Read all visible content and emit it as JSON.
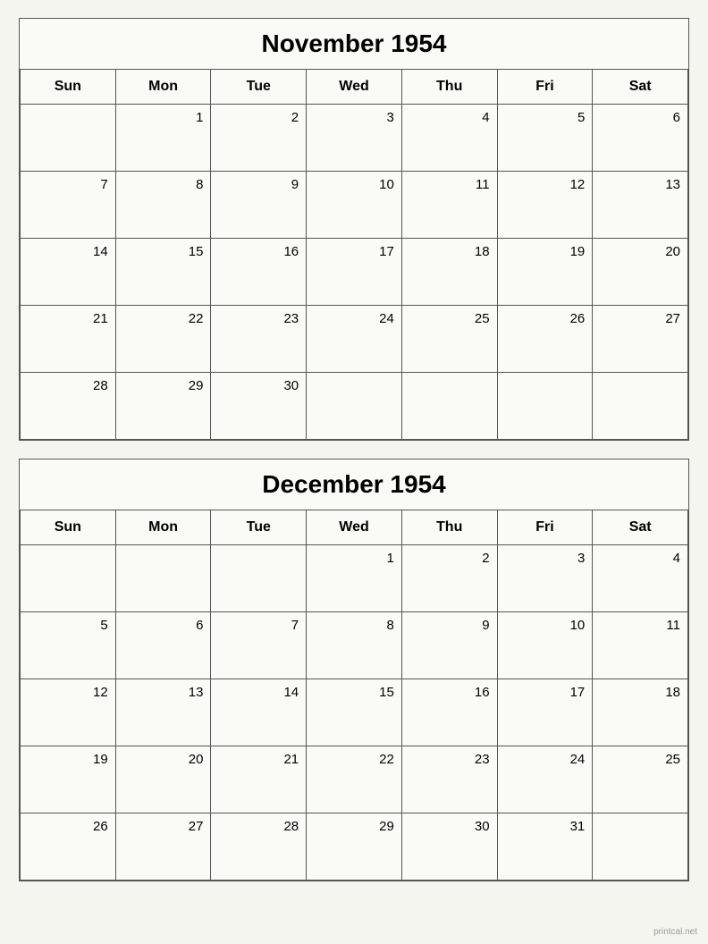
{
  "november": {
    "title": "November 1954",
    "headers": [
      "Sun",
      "Mon",
      "Tue",
      "Wed",
      "Thu",
      "Fri",
      "Sat"
    ],
    "weeks": [
      [
        "",
        "1",
        "2",
        "3",
        "4",
        "5",
        "6"
      ],
      [
        "7",
        "8",
        "9",
        "10",
        "11",
        "12",
        "13"
      ],
      [
        "14",
        "15",
        "16",
        "17",
        "18",
        "19",
        "20"
      ],
      [
        "21",
        "22",
        "23",
        "24",
        "25",
        "26",
        "27"
      ],
      [
        "28",
        "29",
        "30",
        "",
        "",
        "",
        ""
      ]
    ]
  },
  "december": {
    "title": "December 1954",
    "headers": [
      "Sun",
      "Mon",
      "Tue",
      "Wed",
      "Thu",
      "Fri",
      "Sat"
    ],
    "weeks": [
      [
        "",
        "",
        "",
        "1",
        "2",
        "3",
        "4"
      ],
      [
        "5",
        "6",
        "7",
        "8",
        "9",
        "10",
        "11"
      ],
      [
        "12",
        "13",
        "14",
        "15",
        "16",
        "17",
        "18"
      ],
      [
        "19",
        "20",
        "21",
        "22",
        "23",
        "24",
        "25"
      ],
      [
        "26",
        "27",
        "28",
        "29",
        "30",
        "31",
        ""
      ]
    ]
  },
  "watermark": "printcal.net"
}
